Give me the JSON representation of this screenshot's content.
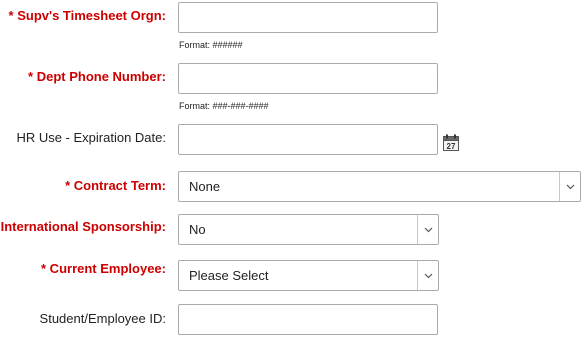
{
  "fields": {
    "supv_orgn": {
      "label": "* Supv's Timesheet Orgn:",
      "value": "",
      "hint": "Format: ######"
    },
    "dept_phone": {
      "label": "* Dept Phone Number:",
      "value": "",
      "hint": "Format: ###-###-####"
    },
    "hr_expiration": {
      "label": "HR Use - Expiration Date:",
      "value": "",
      "calendar_day": "27"
    },
    "contract_term": {
      "label": "* Contract Term:",
      "selected": "None"
    },
    "intl_sponsorship": {
      "label": "International Sponsorship:",
      "selected": "No"
    },
    "current_employee": {
      "label": "* Current Employee:",
      "selected": "Please Select"
    },
    "student_employee_id": {
      "label": "Student/Employee ID:",
      "value": ""
    }
  },
  "colors": {
    "required_label": "#cc0000",
    "border": "#aaaaaa"
  },
  "icons": {
    "calendar": "calendar-icon",
    "dropdown": "chevron-down-icon"
  }
}
